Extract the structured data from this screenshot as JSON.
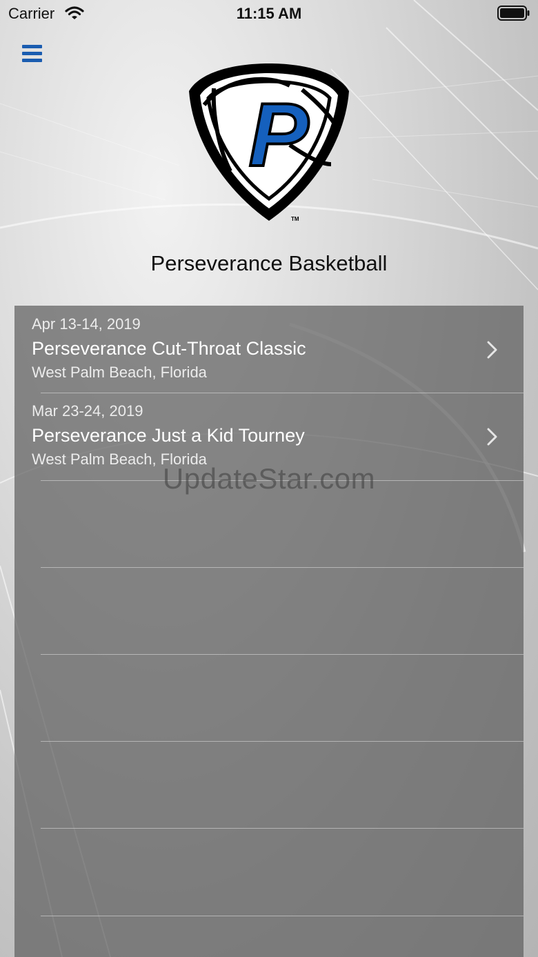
{
  "status_bar": {
    "carrier": "Carrier",
    "time": "11:15 AM"
  },
  "header": {
    "menu_icon": "hamburger-menu-icon",
    "logo_letter": "P",
    "logo_trademark": "TM",
    "title": "Perseverance Basketball"
  },
  "events": [
    {
      "date": "Apr 13-14, 2019",
      "name": "Perseverance Cut-Throat Classic",
      "location": "West Palm Beach, Florida"
    },
    {
      "date": "Mar 23-24, 2019",
      "name": "Perseverance Just a Kid Tourney",
      "location": "West Palm Beach, Florida"
    }
  ],
  "watermark": "UpdateStar.com",
  "colors": {
    "accent": "#1a5cb0",
    "logo_blue": "#1560bd",
    "panel": "#606060"
  }
}
